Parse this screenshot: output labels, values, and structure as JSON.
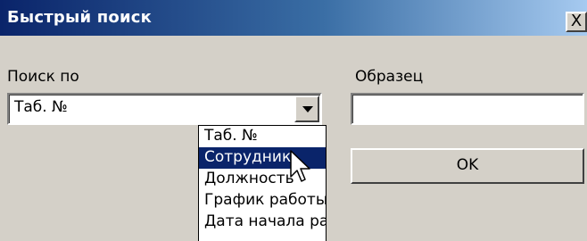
{
  "window": {
    "title": "Быстрый поиск",
    "close_glyph": "X"
  },
  "search_by": {
    "label": "Поиск по",
    "selected": "Таб. №"
  },
  "sample": {
    "label": "Образец",
    "value": ""
  },
  "dropdown": {
    "items": [
      "Таб. №",
      "Сотрудник",
      "Должность",
      "График работы",
      "Дата начала работы"
    ],
    "highlighted": "Сотрудник"
  },
  "ok_button": {
    "label": "OK"
  },
  "colors": {
    "selection": "#0a246a",
    "face": "#d4d0c8"
  },
  "icons": {
    "combo_arrow": "triangle-down-icon",
    "pointer": "arrow-cursor-icon"
  }
}
